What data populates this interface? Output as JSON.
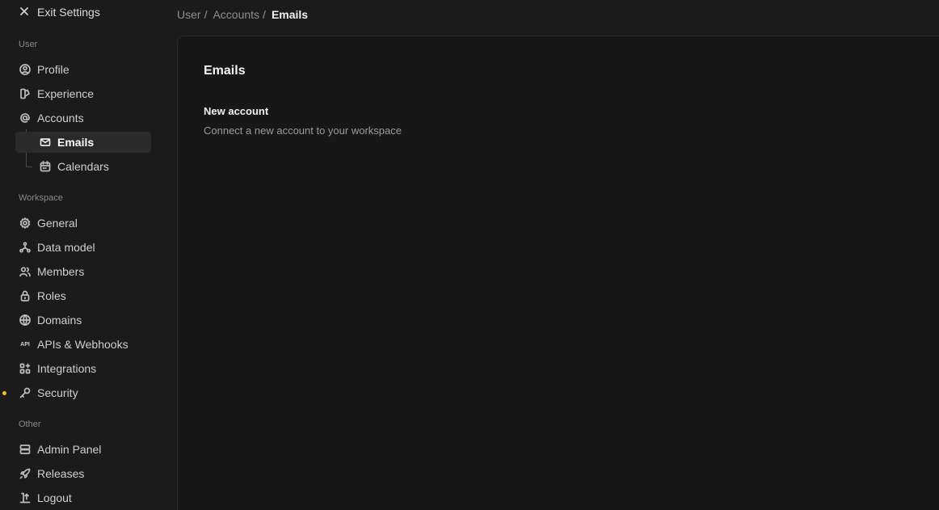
{
  "sidebar": {
    "exit_label": "Exit Settings",
    "sections": {
      "user": "User",
      "workspace": "Workspace",
      "other": "Other"
    },
    "user_items": {
      "profile": "Profile",
      "experience": "Experience",
      "accounts": "Accounts",
      "emails": "Emails",
      "calendars": "Calendars"
    },
    "workspace_items": {
      "general": "General",
      "data_model": "Data model",
      "members": "Members",
      "roles": "Roles",
      "domains": "Domains",
      "apis": "APIs & Webhooks",
      "integrations": "Integrations",
      "security": "Security"
    },
    "other_items": {
      "admin_panel": "Admin Panel",
      "releases": "Releases",
      "logout": "Logout"
    },
    "indicator_color": "#f1c40f"
  },
  "breadcrumb": {
    "items": [
      "User",
      "Accounts"
    ],
    "current": "Emails",
    "separator": "/"
  },
  "main": {
    "title": "Emails",
    "card": {
      "title": "New account",
      "description": "Connect a new account to your workspace"
    }
  }
}
